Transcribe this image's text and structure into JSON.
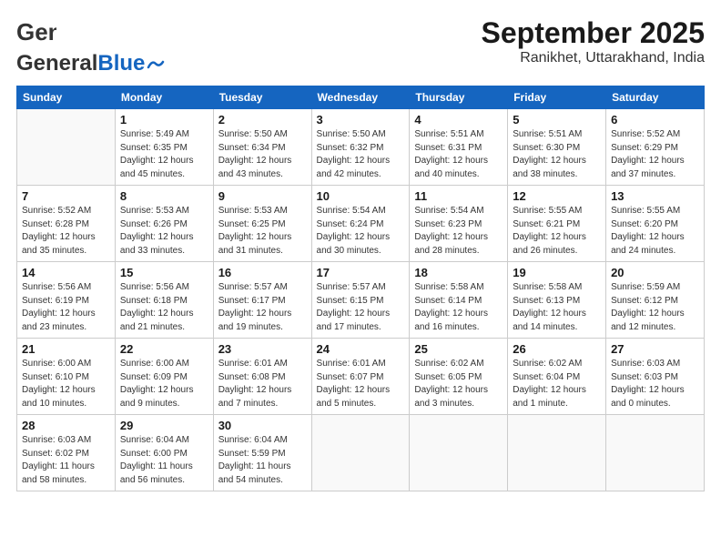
{
  "header": {
    "logo_general": "General",
    "logo_blue": "Blue",
    "month": "September 2025",
    "location": "Ranikhet, Uttarakhand, India"
  },
  "weekdays": [
    "Sunday",
    "Monday",
    "Tuesday",
    "Wednesday",
    "Thursday",
    "Friday",
    "Saturday"
  ],
  "weeks": [
    [
      {
        "day": "",
        "info": ""
      },
      {
        "day": "1",
        "info": "Sunrise: 5:49 AM\nSunset: 6:35 PM\nDaylight: 12 hours\nand 45 minutes."
      },
      {
        "day": "2",
        "info": "Sunrise: 5:50 AM\nSunset: 6:34 PM\nDaylight: 12 hours\nand 43 minutes."
      },
      {
        "day": "3",
        "info": "Sunrise: 5:50 AM\nSunset: 6:32 PM\nDaylight: 12 hours\nand 42 minutes."
      },
      {
        "day": "4",
        "info": "Sunrise: 5:51 AM\nSunset: 6:31 PM\nDaylight: 12 hours\nand 40 minutes."
      },
      {
        "day": "5",
        "info": "Sunrise: 5:51 AM\nSunset: 6:30 PM\nDaylight: 12 hours\nand 38 minutes."
      },
      {
        "day": "6",
        "info": "Sunrise: 5:52 AM\nSunset: 6:29 PM\nDaylight: 12 hours\nand 37 minutes."
      }
    ],
    [
      {
        "day": "7",
        "info": "Sunrise: 5:52 AM\nSunset: 6:28 PM\nDaylight: 12 hours\nand 35 minutes."
      },
      {
        "day": "8",
        "info": "Sunrise: 5:53 AM\nSunset: 6:26 PM\nDaylight: 12 hours\nand 33 minutes."
      },
      {
        "day": "9",
        "info": "Sunrise: 5:53 AM\nSunset: 6:25 PM\nDaylight: 12 hours\nand 31 minutes."
      },
      {
        "day": "10",
        "info": "Sunrise: 5:54 AM\nSunset: 6:24 PM\nDaylight: 12 hours\nand 30 minutes."
      },
      {
        "day": "11",
        "info": "Sunrise: 5:54 AM\nSunset: 6:23 PM\nDaylight: 12 hours\nand 28 minutes."
      },
      {
        "day": "12",
        "info": "Sunrise: 5:55 AM\nSunset: 6:21 PM\nDaylight: 12 hours\nand 26 minutes."
      },
      {
        "day": "13",
        "info": "Sunrise: 5:55 AM\nSunset: 6:20 PM\nDaylight: 12 hours\nand 24 minutes."
      }
    ],
    [
      {
        "day": "14",
        "info": "Sunrise: 5:56 AM\nSunset: 6:19 PM\nDaylight: 12 hours\nand 23 minutes."
      },
      {
        "day": "15",
        "info": "Sunrise: 5:56 AM\nSunset: 6:18 PM\nDaylight: 12 hours\nand 21 minutes."
      },
      {
        "day": "16",
        "info": "Sunrise: 5:57 AM\nSunset: 6:17 PM\nDaylight: 12 hours\nand 19 minutes."
      },
      {
        "day": "17",
        "info": "Sunrise: 5:57 AM\nSunset: 6:15 PM\nDaylight: 12 hours\nand 17 minutes."
      },
      {
        "day": "18",
        "info": "Sunrise: 5:58 AM\nSunset: 6:14 PM\nDaylight: 12 hours\nand 16 minutes."
      },
      {
        "day": "19",
        "info": "Sunrise: 5:58 AM\nSunset: 6:13 PM\nDaylight: 12 hours\nand 14 minutes."
      },
      {
        "day": "20",
        "info": "Sunrise: 5:59 AM\nSunset: 6:12 PM\nDaylight: 12 hours\nand 12 minutes."
      }
    ],
    [
      {
        "day": "21",
        "info": "Sunrise: 6:00 AM\nSunset: 6:10 PM\nDaylight: 12 hours\nand 10 minutes."
      },
      {
        "day": "22",
        "info": "Sunrise: 6:00 AM\nSunset: 6:09 PM\nDaylight: 12 hours\nand 9 minutes."
      },
      {
        "day": "23",
        "info": "Sunrise: 6:01 AM\nSunset: 6:08 PM\nDaylight: 12 hours\nand 7 minutes."
      },
      {
        "day": "24",
        "info": "Sunrise: 6:01 AM\nSunset: 6:07 PM\nDaylight: 12 hours\nand 5 minutes."
      },
      {
        "day": "25",
        "info": "Sunrise: 6:02 AM\nSunset: 6:05 PM\nDaylight: 12 hours\nand 3 minutes."
      },
      {
        "day": "26",
        "info": "Sunrise: 6:02 AM\nSunset: 6:04 PM\nDaylight: 12 hours\nand 1 minute."
      },
      {
        "day": "27",
        "info": "Sunrise: 6:03 AM\nSunset: 6:03 PM\nDaylight: 12 hours\nand 0 minutes."
      }
    ],
    [
      {
        "day": "28",
        "info": "Sunrise: 6:03 AM\nSunset: 6:02 PM\nDaylight: 11 hours\nand 58 minutes."
      },
      {
        "day": "29",
        "info": "Sunrise: 6:04 AM\nSunset: 6:00 PM\nDaylight: 11 hours\nand 56 minutes."
      },
      {
        "day": "30",
        "info": "Sunrise: 6:04 AM\nSunset: 5:59 PM\nDaylight: 11 hours\nand 54 minutes."
      },
      {
        "day": "",
        "info": ""
      },
      {
        "day": "",
        "info": ""
      },
      {
        "day": "",
        "info": ""
      },
      {
        "day": "",
        "info": ""
      }
    ]
  ]
}
